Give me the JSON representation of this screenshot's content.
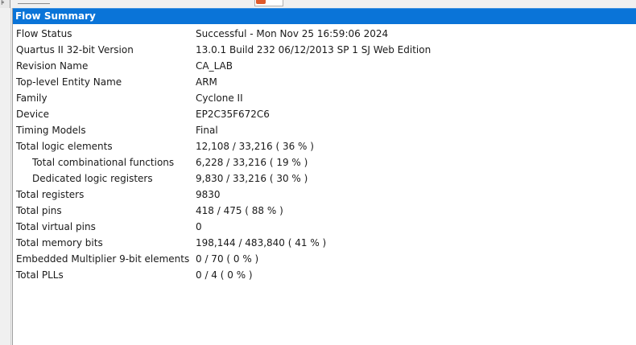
{
  "panel": {
    "title": "Flow Summary"
  },
  "rows": [
    {
      "label": "Flow Status",
      "value": "Successful - Mon Nov 25 16:59:06 2024",
      "indent": false
    },
    {
      "label": "Quartus II 32-bit Version",
      "value": "13.0.1 Build 232 06/12/2013 SP 1 SJ Web Edition",
      "indent": false
    },
    {
      "label": "Revision Name",
      "value": "CA_LAB",
      "indent": false
    },
    {
      "label": "Top-level Entity Name",
      "value": "ARM",
      "indent": false
    },
    {
      "label": "Family",
      "value": "Cyclone II",
      "indent": false
    },
    {
      "label": "Device",
      "value": "EP2C35F672C6",
      "indent": false
    },
    {
      "label": "Timing Models",
      "value": "Final",
      "indent": false
    },
    {
      "label": "Total logic elements",
      "value": "12,108 / 33,216 ( 36 % )",
      "indent": false
    },
    {
      "label": "Total combinational functions",
      "value": "6,228 / 33,216 ( 19 % )",
      "indent": true
    },
    {
      "label": "Dedicated logic registers",
      "value": "9,830 / 33,216 ( 30 % )",
      "indent": true
    },
    {
      "label": "Total registers",
      "value": "9830",
      "indent": false
    },
    {
      "label": "Total pins",
      "value": "418 / 475 ( 88 % )",
      "indent": false
    },
    {
      "label": "Total virtual pins",
      "value": "0",
      "indent": false
    },
    {
      "label": "Total memory bits",
      "value": "198,144 / 483,840 ( 41 % )",
      "indent": false
    },
    {
      "label": "Embedded Multiplier 9-bit elements",
      "value": "0 / 70 ( 0 % )",
      "indent": false
    },
    {
      "label": "Total PLLs",
      "value": "0 / 4 ( 0 % )",
      "indent": false
    }
  ],
  "colors": {
    "title_bar": "#0a74d8",
    "title_text": "#ffffff",
    "body_text": "#1a1a1a",
    "tab_close": "#e05a2a"
  }
}
